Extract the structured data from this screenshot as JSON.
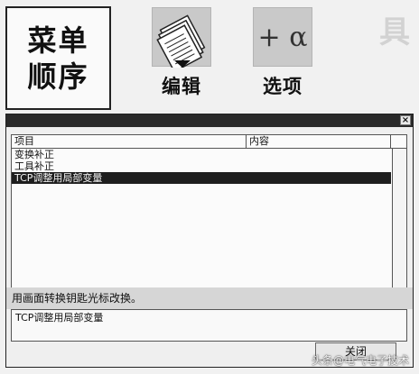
{
  "toolbar": {
    "menu_order_lines": [
      "菜单",
      "顺序"
    ],
    "edit_label": "编辑",
    "options_label": "选项",
    "options_icon_text": "+ α"
  },
  "dialog": {
    "close_glyph": "×",
    "columns": [
      "项目",
      "内容"
    ],
    "rows": [
      "变换补正",
      "工具补正",
      "TCP调整用局部变量"
    ],
    "selected_index": 2,
    "hint": "用画面转换钥匙光标改换。",
    "detail_value": "TCP调整用局部变量",
    "close_button_label": "关闭"
  },
  "watermark": "头条@电气电子技术",
  "icons": [
    "notepad-icon",
    "alpha-icon"
  ]
}
